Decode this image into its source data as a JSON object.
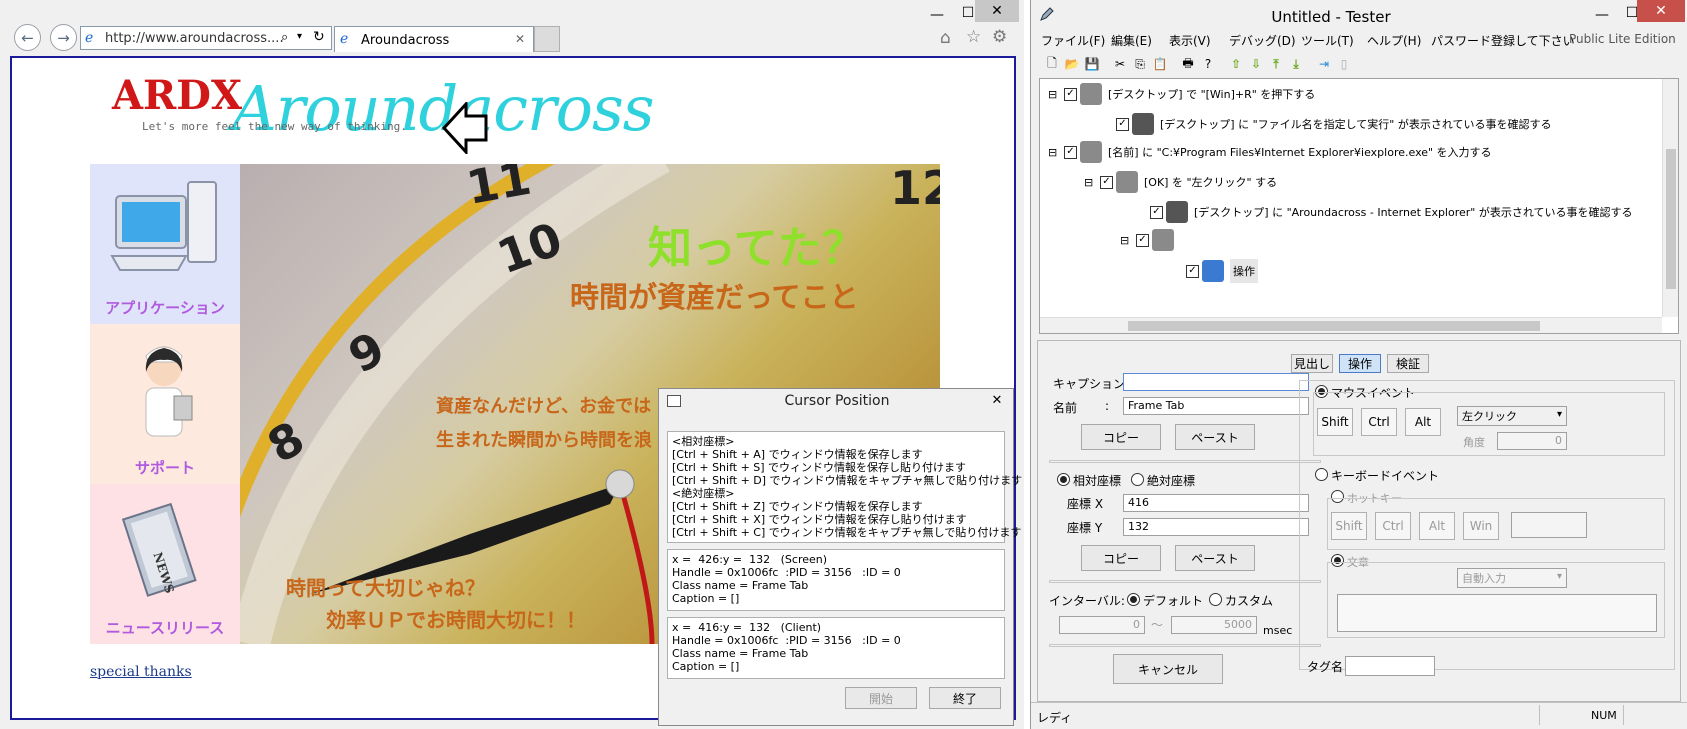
{
  "ie": {
    "address": "http://www.aroundacross....",
    "tab_title": "Aroundacross",
    "page": {
      "logo_text": "ARDX",
      "logo_script": "Aroundacross",
      "tagline": "Let's more feel the new way of thinking.",
      "side_items": [
        {
          "label": "アプリケーション"
        },
        {
          "label": "サポート"
        },
        {
          "label": "ニュースリリース"
        }
      ],
      "hero_lines": [
        "知ってた？",
        "時間が資産だってこと",
        "資産なんだけど、お金では",
        "生まれた瞬間から時間を浪",
        "時間って大切じゃね？",
        "効率ＵＰでお時間大切に！！"
      ],
      "special_thanks": "special thanks"
    }
  },
  "cursor_dialog": {
    "title": "Cursor Position",
    "hotkeys": [
      "<相対座標>",
      "[Ctrl + Shift + A] でウィンドウ情報を保存します",
      "[Ctrl + Shift + S] でウィンドウ情報を保存し貼り付けます",
      "[Ctrl + Shift + D] でウィンドウ情報をキャプチャ無しで貼り付けます",
      "<絶対座標>",
      "[Ctrl + Shift + Z] でウィンドウ情報を保存します",
      "[Ctrl + Shift + X] でウィンドウ情報を保存し貼り付けます",
      "[Ctrl + Shift + C] でウィンドウ情報をキャプチャ無しで貼り付けます"
    ],
    "screen_info": [
      "x =  426:y =  132   (Screen)",
      "Handle = 0x1006fc  :PID = 3156   :ID = 0",
      "Class name = Frame Tab",
      "Caption = []"
    ],
    "client_info": [
      "x =  416:y =  132   (Client)",
      "Handle = 0x1006fc  :PID = 3156   :ID = 0",
      "Class name = Frame Tab",
      "Caption = []"
    ],
    "start_label": "開始",
    "end_label": "終了"
  },
  "tester": {
    "title": "Untitled - Tester",
    "menu": [
      "ファイル(F)",
      "編集(E)",
      "表示(V)",
      "デバッグ(D)",
      "ツール(T)",
      "ヘルプ(H)",
      "パスワード登録して下さい"
    ],
    "edition": "Public Lite Edition",
    "tree": [
      "[デスクトップ] で \"[Win]+R\" を押下する",
      "[デスクトップ] に \"ファイル名を指定して実行\" が表示されている事を確認する",
      "[名前] に \"C:¥Program Files¥Internet Explorer¥iexplore.exe\" を入力する",
      "[OK] を \"左クリック\" する",
      "[デスクトップ] に \"Aroundacross - Internet Explorer\" が表示されている事を確認する",
      "",
      "操作"
    ],
    "tabs": [
      "見出し",
      "操作",
      "検証"
    ],
    "caption_label": "キャプション:",
    "caption_value": "",
    "name_label": "名前",
    "name_value": "Frame Tab",
    "copy_label": "コピー",
    "paste_label": "ペースト",
    "relative_label": "相対座標",
    "absolute_label": "絶対座標",
    "x_label": "座標 X",
    "x_value": "416",
    "y_label": "座標 Y",
    "y_value": "132",
    "interval_label": "インターバル:",
    "default_label": "デフォルト",
    "custom_label": "カスタム",
    "interval_from": "0",
    "interval_to": "5000",
    "msec_label": "msec",
    "cancel_label": "キャンセル",
    "mouse_event_label": "マウスイベント",
    "shift_label": "Shift",
    "ctrl_label": "Ctrl",
    "alt_label": "Alt",
    "win_label": "Win",
    "click_select": "左クリック",
    "angle_label": "角度",
    "angle_value": "0",
    "keyboard_event_label": "キーボードイベント",
    "hotkey_label": "ホットキー",
    "sentence_label": "文章",
    "auto_input": "自動入力",
    "tag_label": "タグ名",
    "tag_value": "",
    "status_left": "レディ",
    "status_num": "NUM"
  }
}
